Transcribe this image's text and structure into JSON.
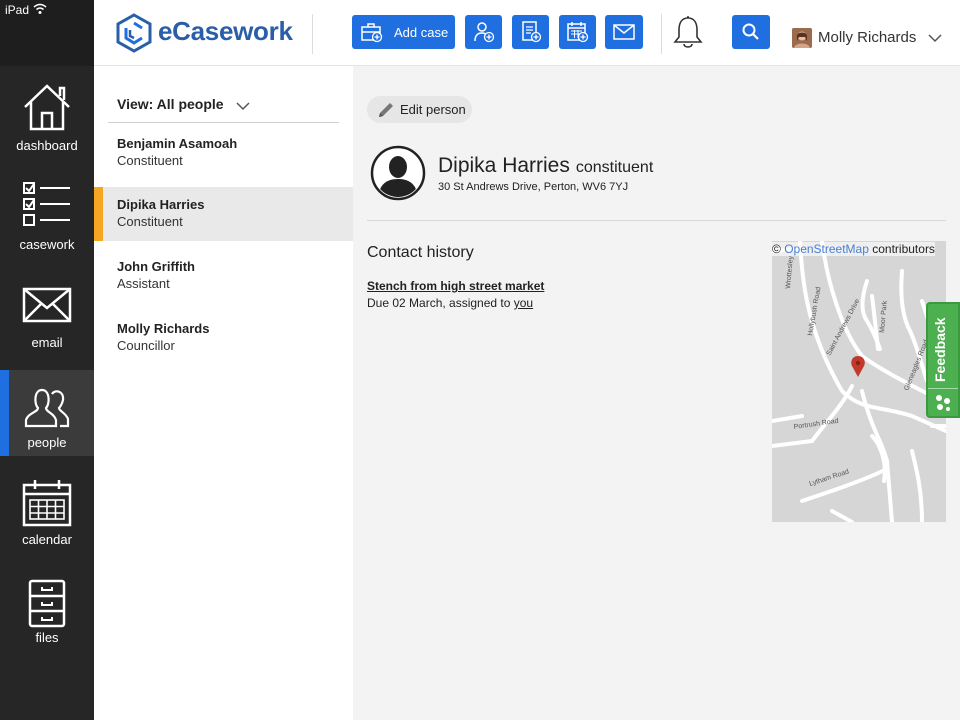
{
  "status_bar": {
    "device": "iPad"
  },
  "header": {
    "logo": "eCasework",
    "add_case_label": "Add case",
    "user_name": "Molly Richards"
  },
  "nav": {
    "items": [
      {
        "label": "dashboard",
        "icon": "home-icon"
      },
      {
        "label": "casework",
        "icon": "checklist-icon"
      },
      {
        "label": "email",
        "icon": "envelope-icon"
      },
      {
        "label": "people",
        "icon": "people-icon",
        "active": true
      },
      {
        "label": "calendar",
        "icon": "calendar-icon"
      },
      {
        "label": "files",
        "icon": "filing-cabinet-icon"
      }
    ]
  },
  "list": {
    "view_label": "View: All people",
    "people": [
      {
        "name": "Benjamin Asamoah",
        "role": "Constituent"
      },
      {
        "name": "Dipika Harries",
        "role": "Constituent",
        "selected": true
      },
      {
        "name": "John Griffith",
        "role": "Assistant"
      },
      {
        "name": "Molly Richards",
        "role": "Councillor"
      }
    ]
  },
  "detail": {
    "edit_label": "Edit person",
    "name": "Dipika Harries",
    "type": "constituent",
    "address": "30 St Andrews Drive, Perton, WV6 7YJ",
    "history_heading": "Contact history",
    "cases": [
      {
        "title": "Stench from high street market",
        "due_prefix": "Due 02 March, assigned to ",
        "assignee": "you"
      }
    ]
  },
  "map": {
    "attribution_prefix": "©",
    "attribution_link": "OpenStreetMap",
    "attribution_suffix": " contributors",
    "streets": [
      "Wrottesley",
      "Hollybush Road",
      "Saint Andrews Drive",
      "Moor Park",
      "Gleneagles Road",
      "Portrush Road",
      "Lytham Road"
    ]
  },
  "feedback": {
    "label": "Feedback"
  },
  "colors": {
    "accent": "#1f6fe0",
    "selected_marker": "#f5a623",
    "feedback": "#4caf50",
    "rail": "#262626"
  }
}
